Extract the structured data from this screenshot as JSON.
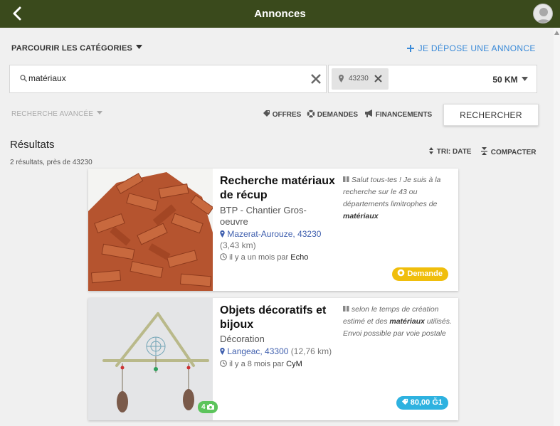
{
  "header": {
    "title": "Annonces"
  },
  "toolbar": {
    "categories_label": "PARCOURIR LES CATÉGORIES",
    "depose_label": "JE DÉPOSE UNE ANNONCE"
  },
  "search": {
    "query": "matériaux",
    "location_chip": "43230",
    "radius": "50 KM"
  },
  "filters": {
    "advanced_label": "RECHERCHE AVANCÉE",
    "offres": "OFFRES",
    "demandes": "DEMANDES",
    "financements": "FINANCEMENTS",
    "search_button": "RECHERCHER"
  },
  "results": {
    "title": "Résultats",
    "count": "2 résultats, près de 43230",
    "sort_label": "TRI: DATE",
    "compact_label": "COMPACTER"
  },
  "listings": [
    {
      "title": "Recherche matériaux de récup",
      "category": "BTP - Chantier Gros-oeuvre",
      "location": "Mazerat-Aurouze, 43230",
      "distance": "(3,43 km)",
      "time_prefix": "il y a un mois par",
      "author": "Echo",
      "desc_before": "Salut tous-tes ! Je suis à la recherche sur le 43 ou départements limitrophes de",
      "desc_bold": "matériaux",
      "desc_after": "",
      "badge": "Demande"
    },
    {
      "title": "Objets décoratifs et bijoux",
      "category": "Décoration",
      "location": "Langeac, 43300",
      "distance": "(12,76 km)",
      "time_prefix": "il y a 8 mois par",
      "author": "CyM",
      "desc_before": "selon le temps de création estimé et des",
      "desc_bold": "matériaux",
      "desc_after": "utilisés. Envoi possible par voie postale",
      "badge": "80,00 Ğ1",
      "photo_count": "4"
    }
  ],
  "colors": {
    "header_bg": "#3a4a1c",
    "link_blue": "#3a8ad8",
    "badge_demande": "#f0be0c",
    "badge_price": "#2eb2e0",
    "photo_badge": "#5cc45c"
  }
}
